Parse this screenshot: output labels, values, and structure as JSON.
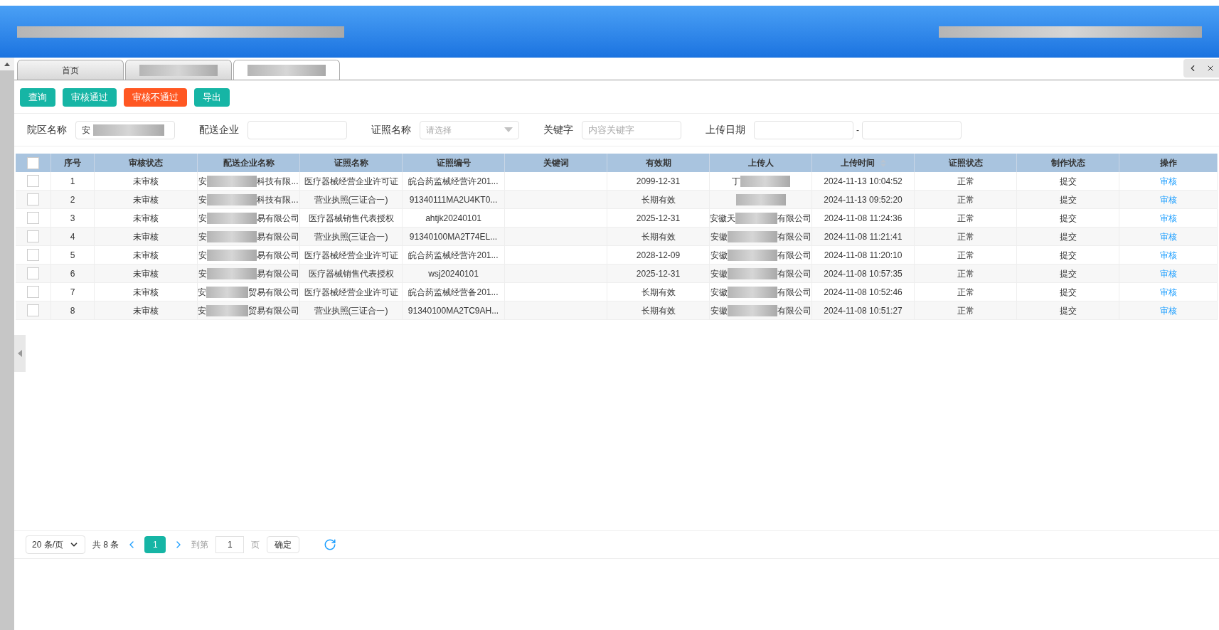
{
  "tabs": [
    {
      "label": "首页",
      "selected": false
    },
    {
      "selected": false
    },
    {
      "selected": true
    }
  ],
  "toolbar": [
    {
      "label": "查询",
      "kind": "primary"
    },
    {
      "label": "审核通过",
      "kind": "primary"
    },
    {
      "label": "审核不通过",
      "kind": "danger"
    },
    {
      "label": "导出",
      "kind": "primary"
    }
  ],
  "filters": [
    {
      "label": "院区名称",
      "kind": "redacted",
      "prefix": "安"
    },
    {
      "label": "配送企业",
      "kind": "text"
    },
    {
      "label": "证照名称",
      "kind": "select",
      "placeholder": "请选择"
    },
    {
      "label": "关键字",
      "kind": "text",
      "placeholder": "内容关键字"
    },
    {
      "label": "上传日期",
      "kind": "range",
      "separator": "-"
    }
  ],
  "table": {
    "all_checked": false,
    "columns": [
      {
        "label": "序号",
        "sortable": false
      },
      {
        "label": "审核状态",
        "sortable": false
      },
      {
        "label": "配送企业名称",
        "sortable": false
      },
      {
        "label": "证照名称",
        "sortable": false
      },
      {
        "label": "证照编号",
        "sortable": false
      },
      {
        "label": "关键词",
        "sortable": false
      },
      {
        "label": "有效期",
        "sortable": false
      },
      {
        "label": "上传人",
        "sortable": false
      },
      {
        "label": "上传时间",
        "sortable": true
      },
      {
        "label": "证照状态",
        "sortable": false
      },
      {
        "label": "制作状态",
        "sortable": false
      },
      {
        "label": "操作",
        "sortable": false
      }
    ],
    "rows": [
      {
        "checked": false,
        "no": "1",
        "status": "未审核",
        "company": {
          "prefix": "安",
          "suffix": "科技有限..."
        },
        "cert": "医疗器械经营企业许可证",
        "number": "皖合药监械经营许201...",
        "validity": "2099-12-31",
        "uploader": {
          "prefix": "丁"
        },
        "time": "2024-11-13 10:04:52",
        "cert_status": "正常",
        "make_status": "提交",
        "action": "审核"
      },
      {
        "checked": false,
        "no": "2",
        "status": "未审核",
        "company": {
          "prefix": "安",
          "suffix": "科技有限..."
        },
        "cert": "营业执照(三证合一)",
        "number": "91340111MA2U4KT0...",
        "validity": "长期有效",
        "uploader": {},
        "time": "2024-11-13 09:52:20",
        "cert_status": "正常",
        "make_status": "提交",
        "action": "审核"
      },
      {
        "checked": false,
        "no": "3",
        "status": "未审核",
        "company": {
          "prefix": "安",
          "suffix": "易有限公司"
        },
        "cert": "医疗器械销售代表授权",
        "number": "ahtjk20240101",
        "validity": "2025-12-31",
        "uploader": {
          "prefix": "安徽天",
          "suffix": "有限公司"
        },
        "time": "2024-11-08 11:24:36",
        "cert_status": "正常",
        "make_status": "提交",
        "action": "审核"
      },
      {
        "checked": false,
        "no": "4",
        "status": "未审核",
        "company": {
          "prefix": "安",
          "suffix": "易有限公司"
        },
        "cert": "营业执照(三证合一)",
        "number": "91340100MA2T74EL...",
        "validity": "长期有效",
        "uploader": {
          "prefix": "安徽",
          "suffix": "有限公司"
        },
        "time": "2024-11-08 11:21:41",
        "cert_status": "正常",
        "make_status": "提交",
        "action": "审核"
      },
      {
        "checked": false,
        "no": "5",
        "status": "未审核",
        "company": {
          "prefix": "安",
          "suffix": "易有限公司"
        },
        "cert": "医疗器械经营企业许可证",
        "number": "皖合药监械经营许201...",
        "validity": "2028-12-09",
        "uploader": {
          "prefix": "安徽",
          "suffix": "有限公司"
        },
        "time": "2024-11-08 11:20:10",
        "cert_status": "正常",
        "make_status": "提交",
        "action": "审核"
      },
      {
        "checked": false,
        "no": "6",
        "status": "未审核",
        "company": {
          "prefix": "安",
          "suffix": "易有限公司"
        },
        "cert": "医疗器械销售代表授权",
        "number": "wsj20240101",
        "validity": "2025-12-31",
        "uploader": {
          "prefix": "安徽",
          "suffix": "有限公司"
        },
        "time": "2024-11-08 10:57:35",
        "cert_status": "正常",
        "make_status": "提交",
        "action": "审核"
      },
      {
        "checked": false,
        "no": "7",
        "status": "未审核",
        "company": {
          "prefix": "安",
          "suffix": "贸易有限公司"
        },
        "cert": "医疗器械经营企业许可证",
        "number": "皖合药监械经营备201...",
        "validity": "长期有效",
        "uploader": {
          "prefix": "安徽",
          "suffix": "有限公司"
        },
        "time": "2024-11-08 10:52:46",
        "cert_status": "正常",
        "make_status": "提交",
        "action": "审核"
      },
      {
        "checked": false,
        "no": "8",
        "status": "未审核",
        "company": {
          "prefix": "安",
          "suffix": "贸易有限公司"
        },
        "cert": "营业执照(三证合一)",
        "number": "91340100MA2TC9AH...",
        "validity": "长期有效",
        "uploader": {
          "prefix": "安徽",
          "suffix": "有限公司"
        },
        "time": "2024-11-08 10:51:27",
        "cert_status": "正常",
        "make_status": "提交",
        "action": "审核"
      }
    ]
  },
  "pagination": {
    "page_size": "20 条/页",
    "total": "共 8 条",
    "pages": [
      {
        "label": "1",
        "selected": true
      }
    ],
    "goto_label": "到第",
    "goto_value": "1",
    "page_unit": "页",
    "confirm": "确定"
  }
}
